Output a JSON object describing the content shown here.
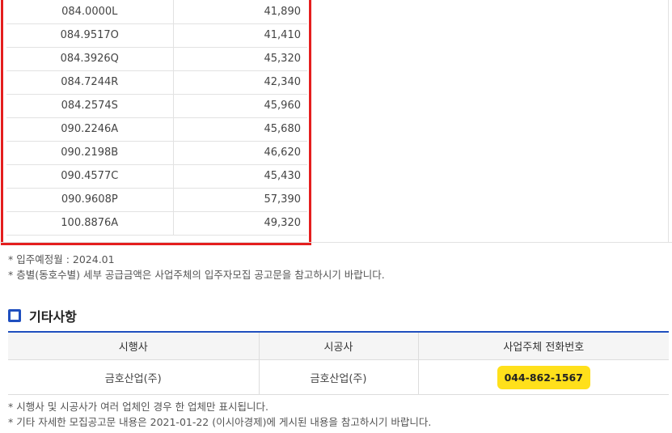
{
  "price_table": {
    "rows": [
      {
        "type": "084.0000L",
        "amount": "41,890"
      },
      {
        "type": "084.9517O",
        "amount": "41,410"
      },
      {
        "type": "084.3926Q",
        "amount": "45,320"
      },
      {
        "type": "084.7244R",
        "amount": "42,340"
      },
      {
        "type": "084.2574S",
        "amount": "45,960"
      },
      {
        "type": "090.2246A",
        "amount": "45,680"
      },
      {
        "type": "090.2198B",
        "amount": "46,620"
      },
      {
        "type": "090.4577C",
        "amount": "45,430"
      },
      {
        "type": "090.9608P",
        "amount": "57,390"
      },
      {
        "type": "100.8876A",
        "amount": "49,320"
      }
    ]
  },
  "notes_top": [
    "* 입주예정월 : 2024.01",
    "* 층별(동호수별) 세부 공급금액은 사업주체의 입주자모집 공고문을 참고하시기 바랍니다."
  ],
  "section": {
    "title": "기타사항"
  },
  "info_table": {
    "headers": [
      "시행사",
      "시공사",
      "사업주체 전화번호"
    ],
    "developer": "금호산업(주)",
    "builder": "금호산업(주)",
    "phone": "044-862-1567"
  },
  "notes_bottom": [
    "* 시행사 및 시공사가 여러 업체인 경우 한 업체만 표시됩니다.",
    "* 기타 자세한 모집공고문 내용은 2021-01-22 (이시아경제)에 게시된 내용을 참고하시기 바랍니다."
  ],
  "colors": {
    "highlight_border": "#e41e1e",
    "accent_blue": "#1f4fbf",
    "phone_badge": "#ffe01b"
  }
}
